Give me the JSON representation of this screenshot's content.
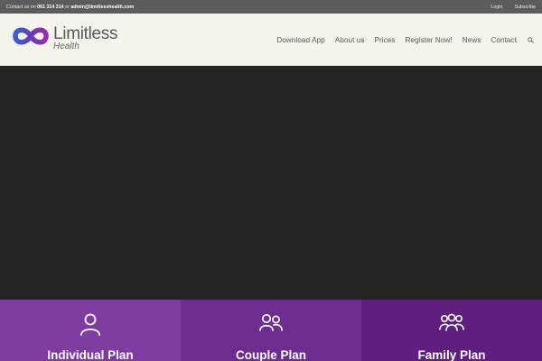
{
  "topbar": {
    "contact_prefix": "Contact us on",
    "phone": "061 314 314",
    "or": "or",
    "email": "admin@limitlesshealth.com",
    "login": "Login",
    "subscribe": "Subscribe"
  },
  "logo": {
    "name": "Limitless",
    "sub": "Health",
    "icon": "infinity-logo-icon"
  },
  "nav": {
    "items": [
      "Download App",
      "About us",
      "Prices",
      "Register Now!",
      "News",
      "Contact"
    ],
    "search_icon": "search-icon"
  },
  "plans": [
    {
      "title": "Individual Plan",
      "icon": "user-icon",
      "color": "#7e3ca1"
    },
    {
      "title": "Couple Plan",
      "icon": "users-icon",
      "color": "#6c2c90"
    },
    {
      "title": "Family Plan",
      "icon": "family-icon",
      "color": "#5e1f7e"
    }
  ],
  "colors": {
    "topbar": "#5a5c5e",
    "header": "#f4f3ec",
    "hero": "#242424",
    "logo_purple": "#7b2fa0",
    "logo_blue": "#3b5fd0"
  }
}
